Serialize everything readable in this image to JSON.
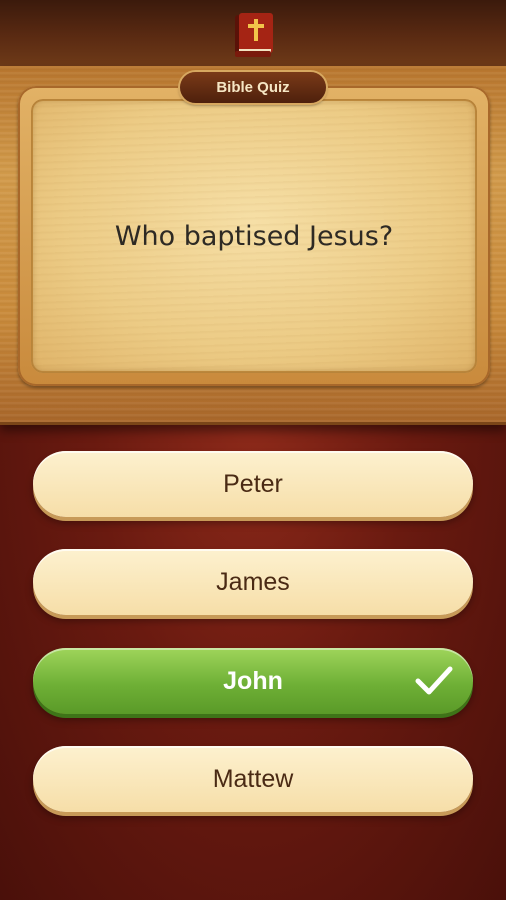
{
  "header": {
    "icon": "bible-book-icon",
    "title": "Bible Quiz"
  },
  "question": {
    "text": "Who baptised Jesus?"
  },
  "answers": [
    {
      "label": "Peter",
      "state": "normal"
    },
    {
      "label": "James",
      "state": "normal"
    },
    {
      "label": "John",
      "state": "correct",
      "icon": "checkmark-icon"
    },
    {
      "label": "Mattew",
      "state": "normal"
    }
  ],
  "colors": {
    "correct": "#6fb036",
    "answer_bg": "#f6dea8",
    "background": "#6a1a10",
    "wood": "#c98a3a"
  }
}
